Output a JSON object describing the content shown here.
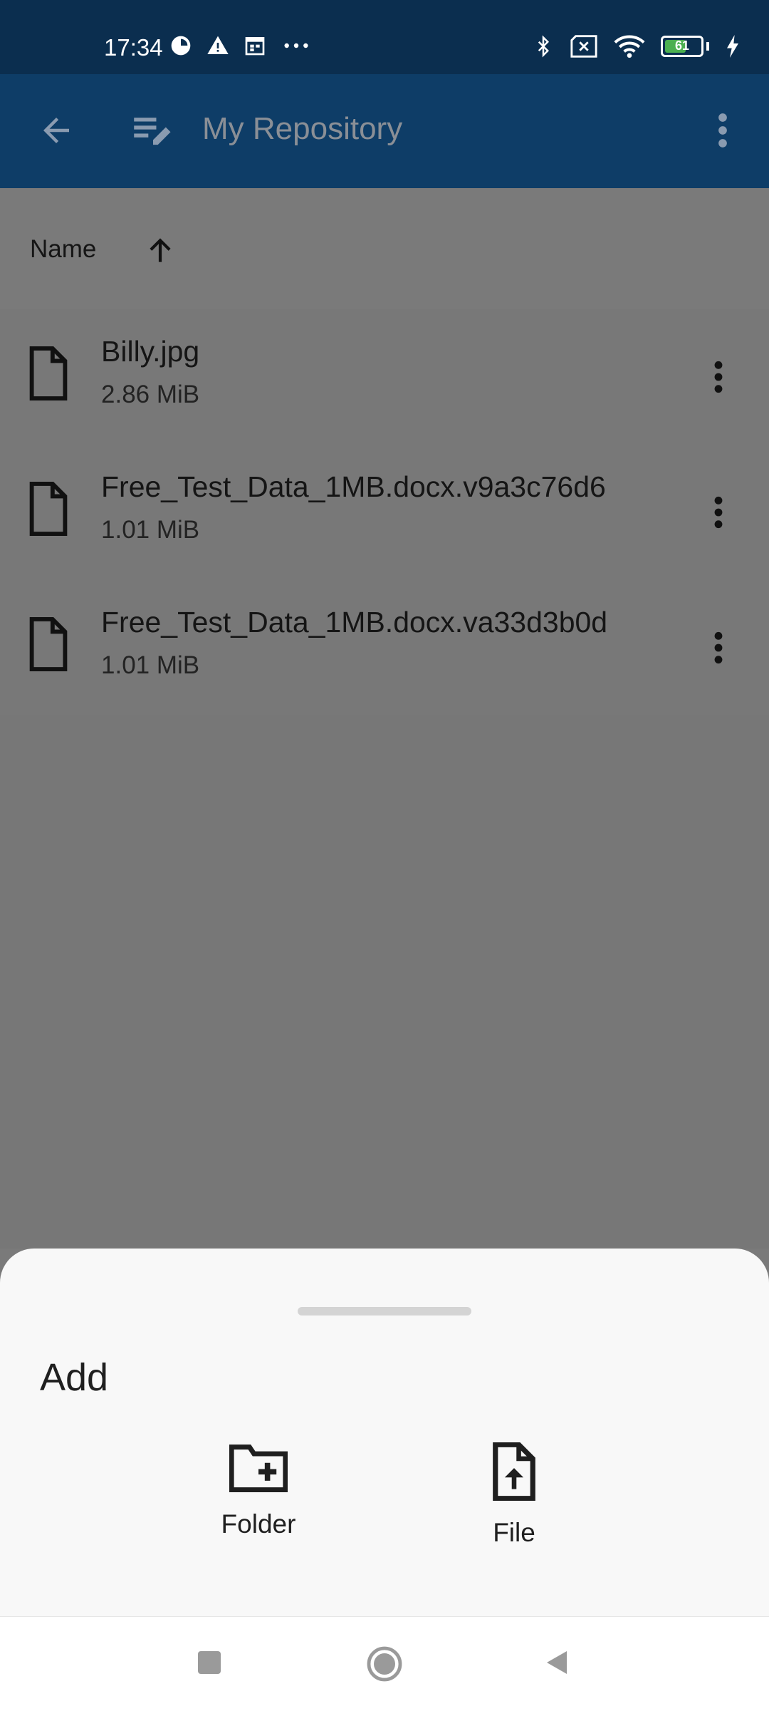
{
  "status_bar": {
    "time": "17:34",
    "battery_level": "61",
    "battery_fraction": 0.61,
    "icons_left": [
      "data-saver-icon",
      "warning-icon",
      "calendar-icon",
      "more-notifications-icon"
    ],
    "icons_right": [
      "bluetooth-icon",
      "no-sim-icon",
      "wifi-icon",
      "battery-icon",
      "charging-icon"
    ]
  },
  "app_bar": {
    "title": "My Repository",
    "icons": [
      "back-arrow-icon",
      "edit-list-icon",
      "more-vert-icon"
    ]
  },
  "sort": {
    "label": "Name",
    "direction_icon": "arrow-up-icon"
  },
  "files": [
    {
      "name": "Billy.jpg",
      "size": "2.86 MiB"
    },
    {
      "name": "Free_Test_Data_1MB.docx.v9a3c76d6",
      "size": "1.01 MiB"
    },
    {
      "name": "Free_Test_Data_1MB.docx.va33d3b0d",
      "size": "1.01 MiB"
    }
  ],
  "bottom_sheet": {
    "title": "Add",
    "actions": [
      {
        "label": "Folder",
        "icon": "create-folder-icon"
      },
      {
        "label": "File",
        "icon": "upload-file-icon"
      }
    ]
  },
  "nav_bar": {
    "buttons": [
      "recents-square-icon",
      "home-circle-icon",
      "back-triangle-icon"
    ]
  },
  "colors": {
    "status_bar": "#0b2e4f",
    "app_bar": "#0e3d67",
    "scrim_content": "#777777",
    "sheet": "#f8f8f8",
    "battery_fill": "#4caf50"
  }
}
